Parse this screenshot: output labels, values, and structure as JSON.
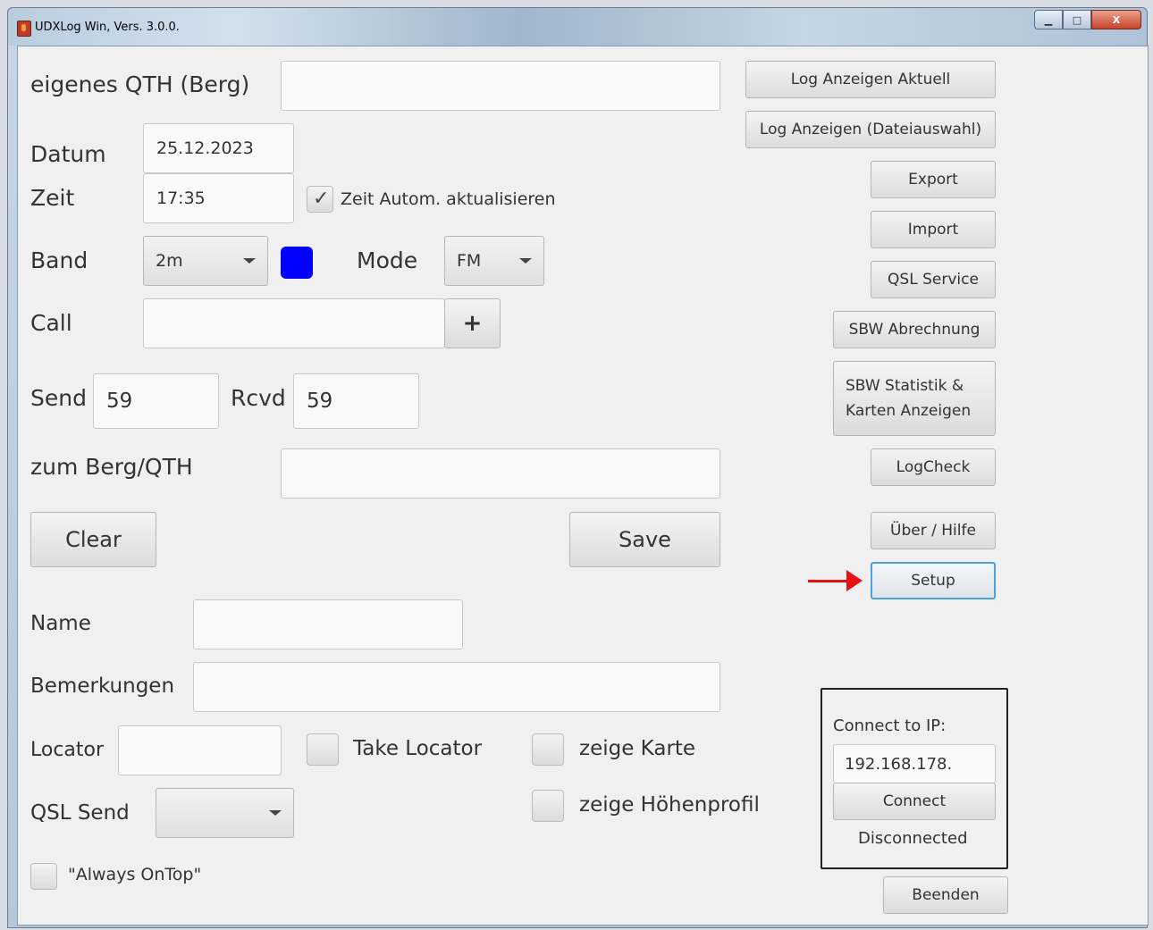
{
  "window": {
    "title": "UDXLog Win, Vers. 3.0.0.",
    "controls": {
      "minimize": "▁",
      "maximize": "□",
      "close": "X"
    }
  },
  "form": {
    "qth_label": "eigenes QTH (Berg)",
    "qth_value": "",
    "date_label": "Datum",
    "date_value": "25.12.2023",
    "time_label": "Zeit",
    "time_value": "17:35",
    "auto_time_label": "Zeit Autom. aktualisieren",
    "auto_time_checked": true,
    "band_label": "Band",
    "band_value": "2m",
    "band_color": "#0000ff",
    "mode_label": "Mode",
    "mode_value": "FM",
    "call_label": "Call",
    "call_value": "",
    "add_call_label": "+",
    "send_label": "Send",
    "send_value": "59",
    "rcvd_label": "Rcvd",
    "rcvd_value": "59",
    "to_qth_label": "zum Berg/QTH",
    "to_qth_value": "",
    "clear_label": "Clear",
    "save_label": "Save",
    "name_label": "Name",
    "name_value": "",
    "remarks_label": "Bemerkungen",
    "remarks_value": "",
    "locator_label": "Locator",
    "locator_value": "",
    "take_locator_label": "Take Locator",
    "show_map_label": "zeige Karte",
    "show_profile_label": "zeige Höhenprofil",
    "qsl_send_label": "QSL Send",
    "qsl_send_value": "",
    "always_on_top_label": "\"Always OnTop\""
  },
  "sidebar": {
    "log_current": "Log Anzeigen Aktuell",
    "log_file": "Log Anzeigen (Dateiauswahl)",
    "export": "Export",
    "import": "Import",
    "qsl_service": "QSL Service",
    "sbw_billing": "SBW Abrechnung",
    "sbw_stats_line1": "SBW Statistik &",
    "sbw_stats_line2": "Karten Anzeigen",
    "logcheck": "LogCheck",
    "about_help": "Über / Hilfe",
    "setup": "Setup",
    "exit": "Beenden"
  },
  "connection": {
    "label": "Connect to IP:",
    "ip_value": "192.168.178.",
    "connect_label": "Connect",
    "status": "Disconnected"
  },
  "annotation": {
    "arrow_color": "#e81010",
    "points_to": "Setup"
  }
}
